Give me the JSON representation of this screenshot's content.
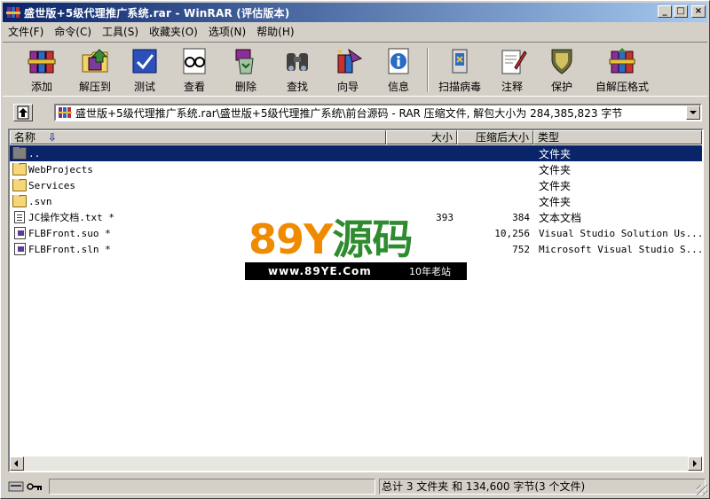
{
  "window": {
    "title": "盛世版+5级代理推广系统.rar - WinRAR (评估版本)",
    "controls": {
      "minimize": "_",
      "maximize": "□",
      "close": "×"
    }
  },
  "menu": [
    "文件(F)",
    "命令(C)",
    "工具(S)",
    "收藏夹(O)",
    "选项(N)",
    "帮助(H)"
  ],
  "toolbar": [
    {
      "label": "添加",
      "icon": "books-add-icon"
    },
    {
      "label": "解压到",
      "icon": "folder-extract-icon"
    },
    {
      "label": "测试",
      "icon": "test-check-icon"
    },
    {
      "label": "查看",
      "icon": "view-glasses-icon"
    },
    {
      "label": "删除",
      "icon": "delete-recycle-icon"
    },
    {
      "label": "查找",
      "icon": "find-binoculars-icon"
    },
    {
      "label": "向导",
      "icon": "wizard-icon"
    },
    {
      "label": "信息",
      "icon": "info-icon"
    },
    {
      "label": "扫描病毒",
      "icon": "virus-scan-icon"
    },
    {
      "label": "注释",
      "icon": "comment-icon"
    },
    {
      "label": "保护",
      "icon": "protect-shield-icon"
    },
    {
      "label": "自解压格式",
      "icon": "sfx-icon"
    }
  ],
  "address": {
    "path": "盛世版+5级代理推广系统.rar\\盛世版+5级代理推广系统\\前台源码 - RAR 压缩文件, 解包大小为 284,385,823 字节"
  },
  "columns": {
    "name": "名称",
    "size": "大小",
    "packed": "压缩后大小",
    "type": "类型"
  },
  "sort_arrow": "⇩",
  "files": [
    {
      "name": "..",
      "size": "",
      "packed": "",
      "type": "文件夹",
      "icon": "folder-up",
      "selected": true
    },
    {
      "name": "WebProjects",
      "size": "",
      "packed": "",
      "type": "文件夹",
      "icon": "folder"
    },
    {
      "name": "Services",
      "size": "",
      "packed": "",
      "type": "文件夹",
      "icon": "folder"
    },
    {
      "name": ".svn",
      "size": "",
      "packed": "",
      "type": "文件夹",
      "icon": "folder"
    },
    {
      "name": "JC操作文档.txt *",
      "size": "393",
      "packed": "384",
      "type": "文本文档",
      "icon": "document"
    },
    {
      "name": "FLBFront.suo *",
      "size": "",
      "packed": "10,256",
      "type": "Visual Studio Solution Us...",
      "icon": "vs-file"
    },
    {
      "name": "FLBFront.sln *",
      "size": "",
      "packed": "752",
      "type": "Microsoft Visual Studio S...",
      "icon": "vs-file"
    }
  ],
  "watermark": {
    "brand_a": "89Y",
    "brand_b": "源码",
    "url": "www.89YE.Com",
    "tag": "10年老站"
  },
  "status": {
    "summary": "总计 3 文件夹 和 134,600 字节(3 个文件)"
  },
  "colors": {
    "title_start": "#0a246a",
    "title_end": "#a6caf0",
    "selection": "#0a246a",
    "face": "#d4d0c8"
  }
}
